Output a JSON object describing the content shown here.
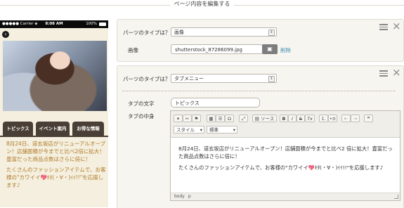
{
  "header": {
    "title": "ページ内容を編集する"
  },
  "phone": {
    "status": {
      "carrier": "●●●●● Carrier ◈",
      "time": "8:08 AM",
      "battery": "100%"
    },
    "back_glyph": "‹",
    "tabs": [
      {
        "label": "トピックス"
      },
      {
        "label": "イベント案内"
      },
      {
        "label": "お得な情報"
      }
    ],
    "paragraphs": [
      "8月24日、道玄坂店がリニューアルオープン！店舗面積が今までと比べ2倍に拡大！豊富だった商品点数はさらに倍に！",
      "たくさんのファッションアイテムで、お客様の\"カワイイ💖ｷﾀ(・∀・)ｲｲ!!\"を応援します♪"
    ]
  },
  "part1": {
    "type_label": "パーツのタイプは？",
    "type_value": "画像",
    "image_label": "画像",
    "filename": "shutterstock_87286099.jpg",
    "delete_label": "削除"
  },
  "part2": {
    "type_label": "パーツのタイプは？",
    "type_value": "タブメニュー",
    "tab_text_label": "タブの文字",
    "tab_text_value": "トピックス",
    "tab_content_label": "タブの中身",
    "toolbar": {
      "source_label": "ソース",
      "style_label": "スタイル",
      "format_label": "標準",
      "bold": "B",
      "italic": "I",
      "strike": "S",
      "clear": "Tx",
      "quote": "❞"
    },
    "content": [
      "8月24日、道玄坂店がリニューアルオープン！店舗面積が今までと比べ2 倍に拡大！豊富だった商品点数はさらに倍に！",
      "たくさんのファッションアイテムで、お客様の\"カワイイ💖ｷﾀ(・∀・)ｲｲ!!\"を応援します♪"
    ],
    "path": [
      "body",
      "p"
    ]
  },
  "colors": {
    "tab_bg": "#4a3f36",
    "phone_text": "#b07a28",
    "link": "#3a8fb8"
  }
}
